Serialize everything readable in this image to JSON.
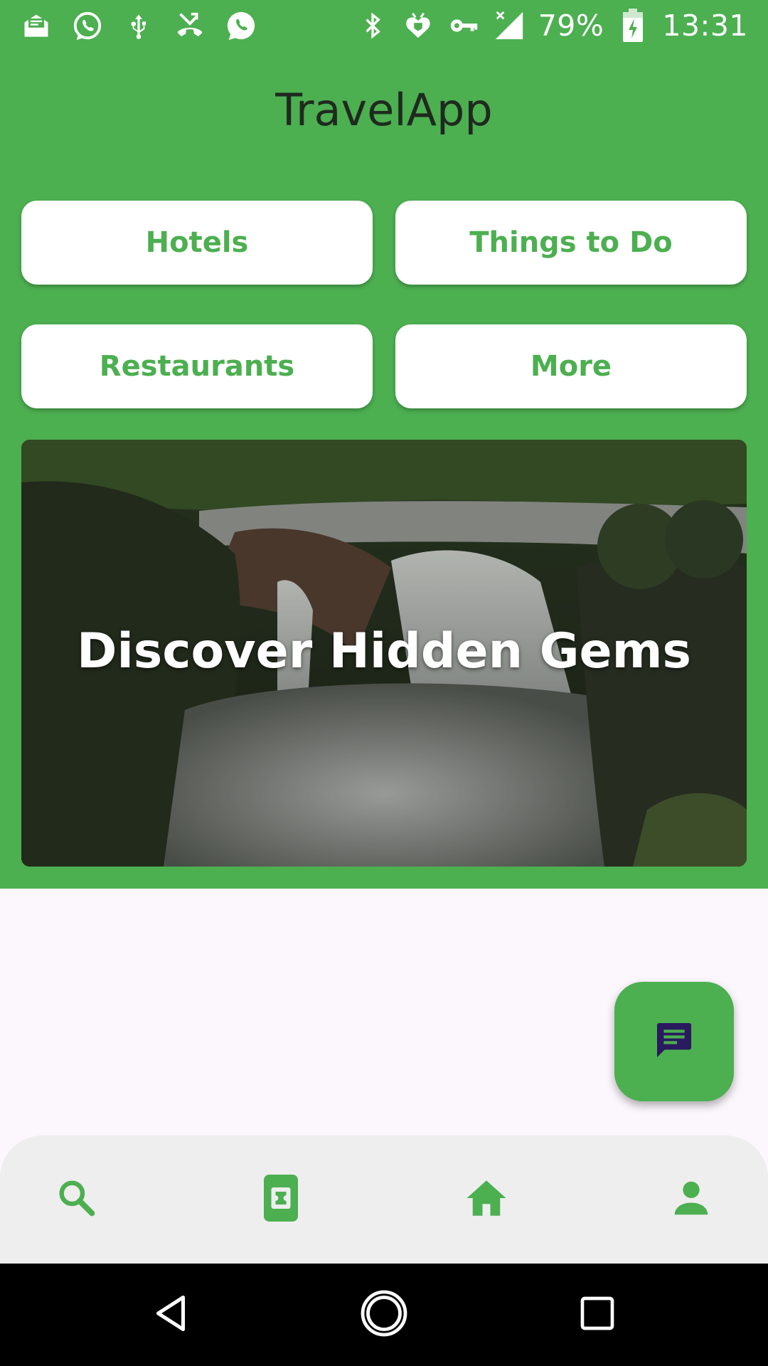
{
  "status_bar": {
    "battery_percent": "79%",
    "time": "13:31",
    "left_icons": [
      "mail-icon",
      "whatsapp-icon",
      "usb-icon",
      "missed-call-icon",
      "whatsapp-icon"
    ],
    "right_icons": [
      "bluetooth-icon",
      "heart-shield-icon",
      "key-icon",
      "signal-icon",
      "battery-charging-icon"
    ]
  },
  "app": {
    "title": "TravelApp",
    "primary_color": "#4caf50"
  },
  "categories": [
    {
      "label": "Hotels"
    },
    {
      "label": "Things to Do"
    },
    {
      "label": "Restaurants"
    },
    {
      "label": "More"
    }
  ],
  "hero": {
    "title": "Discover Hidden Gems",
    "image": "waterfall-photo"
  },
  "fab": {
    "icon": "chat-icon"
  },
  "bottom_nav": {
    "items": [
      {
        "icon": "search-icon"
      },
      {
        "icon": "ticket-icon"
      },
      {
        "icon": "home-icon"
      },
      {
        "icon": "person-icon"
      }
    ]
  },
  "system_nav": {
    "buttons": [
      "back-icon",
      "home-circle-icon",
      "recents-icon"
    ]
  }
}
